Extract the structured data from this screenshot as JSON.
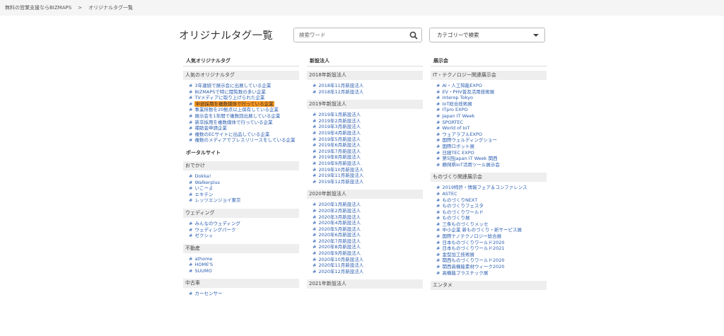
{
  "breadcrumb": {
    "home": "無料の営業支援ならBIZMAPS",
    "separator": ">",
    "current": "オリジナルタグ一覧"
  },
  "page": {
    "title": "オリジナルタグ一覧"
  },
  "search": {
    "placeholder": "検索ワード",
    "icon": "search-icon"
  },
  "category_select": {
    "label": "カテゴリーで検索"
  },
  "link_prefix": "#",
  "col1": {
    "header": "人気オリジナルタグ",
    "popular_sub": "人気のオリジナルタグ",
    "popular": [
      "3年連続で展示会に出展している企業",
      "BIZMAPSで特に閲覧数の多い企業",
      "TVメディアに取り上げられた企業",
      "中途採用を複数媒体で行っている企業",
      "事業所数を20拠点以上保有している企業",
      "展示会を1年間で複数回出展している企業",
      "新卒採用を複数媒体で行っている企業",
      "補助金申請企業",
      "複数のECサイトに出品している企業",
      "複数のメディアでプレスリリースをしている企業"
    ],
    "highlight_index": 3,
    "portal_header": "ポータルサイト",
    "groups": [
      {
        "name": "おでかけ",
        "items": [
          "Dokka!",
          "Walkerplus",
          "いこーよ",
          "エキテン",
          "レッツエンジョイ東京"
        ]
      },
      {
        "name": "ウェディング",
        "items": [
          "みんなのウェディング",
          "ウェディングパーク",
          "ゼクシィ"
        ]
      },
      {
        "name": "不動産",
        "items": [
          "athome",
          "HOME'S",
          "SUUMO"
        ]
      },
      {
        "name": "中古車",
        "items": [
          "カーセンサー"
        ]
      }
    ]
  },
  "col2": {
    "header": "新設法人",
    "groups": [
      {
        "name": "2018年新設法人",
        "items": [
          "2018年11月新設法人",
          "2018年12月新設法人"
        ]
      },
      {
        "name": "2019年新設法人",
        "items": [
          "2019年1月新設法人",
          "2019年2月新設法人",
          "2019年3月新設法人",
          "2019年4月新設法人",
          "2019年5月新設法人",
          "2019年6月新設法人",
          "2019年7月新設法人",
          "2019年8月新設法人",
          "2019年9月新設法人",
          "2019年10月新設法人",
          "2019年11月新設法人",
          "2019年12月新設法人"
        ]
      },
      {
        "name": "2020年新設法人",
        "items": [
          "2020年1月新設法人",
          "2020年2月新設法人",
          "2020年3月新設法人",
          "2020年4月新設法人",
          "2020年5月新設法人",
          "2020年6月新設法人",
          "2020年7月新設法人",
          "2020年8月新設法人",
          "2020年9月新設法人",
          "2020年10月新設法人",
          "2020年11月新設法人",
          "2020年12月新設法人"
        ]
      },
      {
        "name": "2021年新設法人",
        "items": []
      }
    ]
  },
  "col3": {
    "header": "展示会",
    "groups": [
      {
        "name": "IT・テクノロジー関連展示会",
        "items": [
          "AI・人工知能EXPO",
          "EV・PHV普及活用技術展",
          "Interop Tokyo",
          "IoT総合技術展",
          "ITpro EXPO",
          "Japan IT Week",
          "SPORTEC",
          "World of IoT",
          "ウェアラブルEXPO",
          "国際ウェルディングショー",
          "国際ロボット展",
          "日経TEC EXPO",
          "第5回Japan IT Week 関西",
          "静岡県IoT活用ツール展示会"
        ]
      },
      {
        "name": "ものづくり関連展示会",
        "items": [
          "2019特許・情報フェア＆コンファレンス",
          "ASTEC",
          "ものづくりNEXT",
          "ものづくりフェスタ",
          "ものづくりワールド",
          "ものづくり展",
          "三条ものづくりメッセ",
          "中小企業 新ものづくり・新サービス展",
          "国際ナノテクノロジー総合展",
          "日本ものづくりワールド2020",
          "日本ものづくりワールド2021",
          "金型加工技術展",
          "関西ものづくりワールド2020",
          "関西高機能素材ウィーク2020",
          "高機能プラスチック展"
        ]
      },
      {
        "name": "エンタメ",
        "items": []
      }
    ]
  }
}
